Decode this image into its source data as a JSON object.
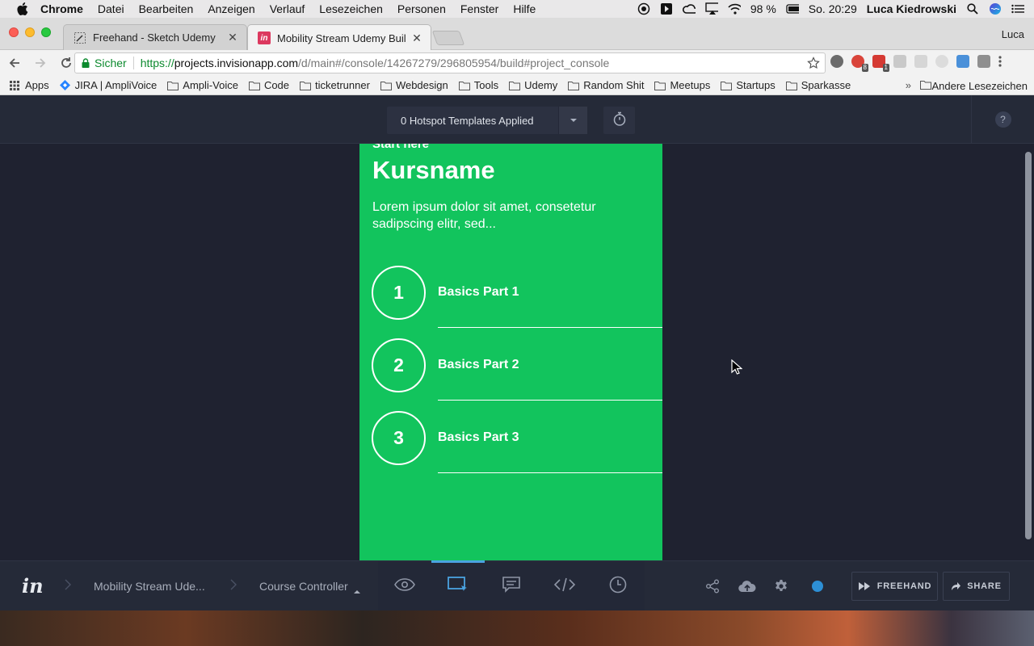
{
  "menubar": {
    "app_name": "Chrome",
    "menus": [
      "Datei",
      "Bearbeiten",
      "Anzeigen",
      "Verlauf",
      "Lesezeichen",
      "Personen",
      "Fenster",
      "Hilfe"
    ],
    "battery": "98 %",
    "datetime": "So. 20:29",
    "user": "Luca Kiedrowski"
  },
  "browser": {
    "tabs": [
      {
        "title": "Freehand - Sketch Udemy"
      },
      {
        "title": "Mobility Stream Udemy Build"
      }
    ],
    "profile": "Luca",
    "url": {
      "secure_label": "Sicher",
      "scheme": "https://",
      "host": "projects.invisionapp.com",
      "path": "/d/main#/console/14267279/296805954/build#project_console"
    },
    "extension_badges": [
      "8",
      "1"
    ],
    "bookmarks": [
      "Apps",
      "JIRA | AmpliVoice",
      "Ampli-Voice",
      "Code",
      "ticketrunner",
      "Webdesign",
      "Tools",
      "Udemy",
      "Random Shit",
      "Meetups",
      "Startups",
      "Sparkasse"
    ],
    "other_bookmarks": "Andere Lesezeichen"
  },
  "app": {
    "hotspot_label": "0 Hotspot Templates Applied",
    "help": "?",
    "screen": {
      "pretitle": "Start here",
      "title": "Kursname",
      "description": "Lorem ipsum dolor sit amet, consetetur sadipscing elitr, sed...",
      "lessons": [
        {
          "number": "1",
          "name": "Basics Part 1"
        },
        {
          "number": "2",
          "name": "Basics Part 2"
        },
        {
          "number": "3",
          "name": "Basics Part 3"
        }
      ]
    },
    "bottombar": {
      "project": "Mobility Stream Ude...",
      "screen": "Course Controller",
      "freehand": "FREEHAND",
      "share": "SHARE"
    }
  },
  "colors": {
    "screen_bg": "#12c45d",
    "app_bg": "#1f2230",
    "accent": "#4aa3e0",
    "status_dot": "#2d8fd5"
  }
}
